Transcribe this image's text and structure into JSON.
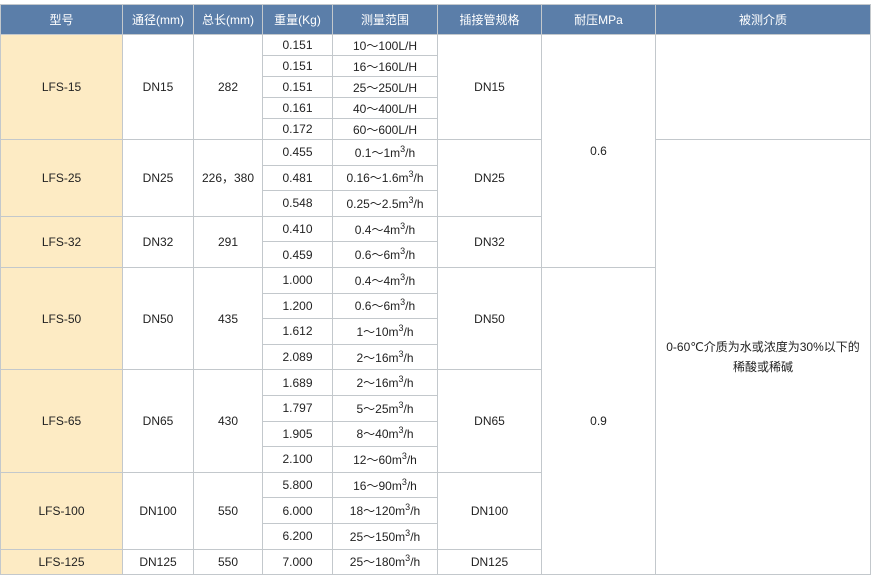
{
  "headers": [
    "型号",
    "通径(mm)",
    "总长(mm)",
    "重量(Kg)",
    "测量范围",
    "插接管规格",
    "耐压MPa",
    "被测介质"
  ],
  "groups": [
    {
      "model": "LFS-15",
      "bore": "DN15",
      "length": "282",
      "pipe": "DN15",
      "rows": [
        {
          "weight": "0.151",
          "range": "10～100L/H"
        },
        {
          "weight": "0.151",
          "range": "16～160L/H"
        },
        {
          "weight": "0.151",
          "range": "25～250L/H"
        },
        {
          "weight": "0.161",
          "range": "40～400L/H"
        },
        {
          "weight": "0.172",
          "range": "60～600L/H"
        }
      ]
    },
    {
      "model": "LFS-25",
      "bore": "DN25",
      "length": "226，380",
      "pipe": "DN25",
      "rows": [
        {
          "weight": "0.455",
          "range": "0.1～1m",
          "unit": "/h"
        },
        {
          "weight": "0.481",
          "range": "0.16～1.6m",
          "unit": "/h"
        },
        {
          "weight": "0.548",
          "range": "0.25～2.5m",
          "unit": "/h"
        }
      ]
    },
    {
      "model": "LFS-32",
      "bore": "DN32",
      "length": "291",
      "pipe": "DN32",
      "rows": [
        {
          "weight": "0.410",
          "range": "0.4～4m",
          "unit": "/h"
        },
        {
          "weight": "0.459",
          "range": "0.6～6m",
          "unit": "/h"
        }
      ]
    },
    {
      "model": "LFS-50",
      "bore": "DN50",
      "length": "435",
      "pipe": "DN50",
      "rows": [
        {
          "weight": "1.000",
          "range": "0.4～4m",
          "unit": "/h"
        },
        {
          "weight": "1.200",
          "range": "0.6～6m",
          "unit": "/h"
        },
        {
          "weight": "1.612",
          "range": "1～10m",
          "unit": "/h"
        },
        {
          "weight": "2.089",
          "range": "2～16m",
          "unit": "/h"
        }
      ]
    },
    {
      "model": "LFS-65",
      "bore": "DN65",
      "length": "430",
      "pipe": "DN65",
      "rows": [
        {
          "weight": "1.689",
          "range": "2～16m",
          "unit": "/h"
        },
        {
          "weight": "1.797",
          "range": "5～25m",
          "unit": "/h"
        },
        {
          "weight": "1.905",
          "range": "8～40m",
          "unit": "/h"
        },
        {
          "weight": "2.100",
          "range": "12～60m",
          "unit": "/h"
        }
      ]
    },
    {
      "model": "LFS-100",
      "bore": "DN100",
      "length": "550",
      "pipe": "DN100",
      "rows": [
        {
          "weight": "5.800",
          "range": "16～90m",
          "unit": "/h"
        },
        {
          "weight": "6.000",
          "range": "18～120m",
          "unit": "/h"
        },
        {
          "weight": "6.200",
          "range": "25～150m",
          "unit": "/h"
        }
      ]
    },
    {
      "model": "LFS-125",
      "bore": "DN125",
      "length": "550",
      "pipe": "DN125",
      "rows": [
        {
          "weight": "7.000",
          "range": "25～180m",
          "unit": "/h"
        }
      ]
    }
  ],
  "pressure": [
    {
      "value": "0.6",
      "span_rows": 10
    },
    {
      "value": "0.9",
      "span_rows": 14
    }
  ],
  "medium_top": "",
  "medium": "0-60℃介质为水或浓度为30%以下的稀酸或稀碱",
  "exponent": "3",
  "colors": {
    "header_bg": "#5b7ea9",
    "header_text": "#ffffff",
    "model_bg": "#fdebc4",
    "border": "#c3c8cc"
  }
}
